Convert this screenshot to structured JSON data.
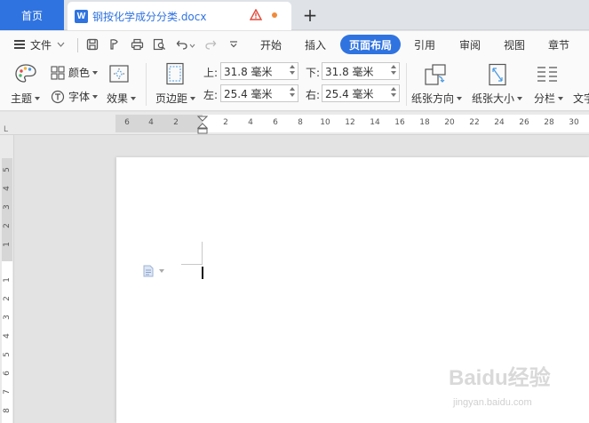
{
  "tabs": {
    "home_label": "首页",
    "doc_icon": "W",
    "doc_title": "钢按化学成分分类.docx",
    "add_label": "+"
  },
  "menu": {
    "file_label": "文件",
    "tabs": [
      "开始",
      "插入",
      "页面布局",
      "引用",
      "审阅",
      "视图",
      "章节"
    ],
    "active_tab": "页面布局"
  },
  "ribbon": {
    "theme_label": "主题",
    "color_label": "颜色",
    "font_label": "字体",
    "effect_label": "效果",
    "margin_label": "页边距",
    "top_label": "上:",
    "top_value": "31.8 毫米",
    "bottom_label": "下:",
    "bottom_value": "31.8 毫米",
    "left_label": "左:",
    "left_value": "25.4 毫米",
    "right_label": "右:",
    "right_value": "25.4 毫米",
    "orientation_label": "纸张方向",
    "size_label": "纸张大小",
    "columns_label": "分栏",
    "text_label": "文字"
  },
  "ruler": {
    "h_numbers": [
      "6",
      "4",
      "2",
      "2",
      "4",
      "6",
      "8",
      "10",
      "12",
      "14",
      "16",
      "18",
      "20",
      "22",
      "24",
      "26",
      "28",
      "30"
    ],
    "v_numbers": [
      "5",
      "4",
      "3",
      "2",
      "1",
      "1",
      "2",
      "3",
      "4",
      "5",
      "6",
      "7",
      "8"
    ],
    "corner_mark": "L"
  },
  "watermark": {
    "brand": "Baidu经验",
    "url": "jingyan.baidu.com"
  },
  "colors": {
    "accent": "#2f73e0",
    "warning": "#e04a3a",
    "modified_dot": "#f08a3a"
  }
}
